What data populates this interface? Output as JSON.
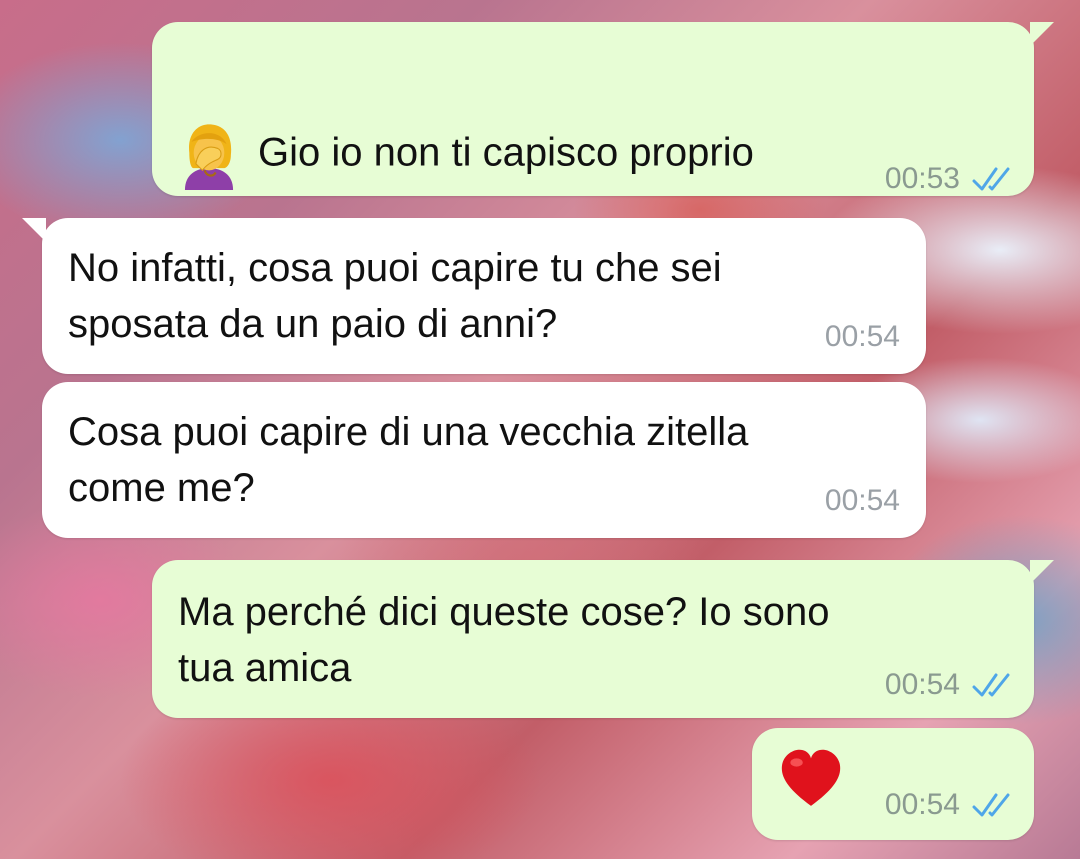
{
  "messages": [
    {
      "direction": "outgoing",
      "emoji": "woman-facepalming",
      "text": "Gio io non ti capisco proprio",
      "time": "00:53",
      "status": "read"
    },
    {
      "direction": "incoming",
      "text": "No infatti, cosa puoi capire tu che sei\nsposata da un paio di anni?",
      "time": "00:54"
    },
    {
      "direction": "incoming",
      "text": "Cosa puoi capire di una vecchia zitella\ncome me?",
      "time": "00:54"
    },
    {
      "direction": "outgoing",
      "text": "Ma perché dici queste cose? Io sono\ntua amica",
      "time": "00:54",
      "status": "read"
    },
    {
      "direction": "outgoing",
      "emoji": "red-heart",
      "time": "00:54",
      "status": "read"
    }
  ],
  "colors": {
    "outgoing_bubble": "#e7fdd5",
    "incoming_bubble": "#ffffff",
    "read_ticks": "#4fa6e8",
    "timestamp": "#8a9a90"
  }
}
